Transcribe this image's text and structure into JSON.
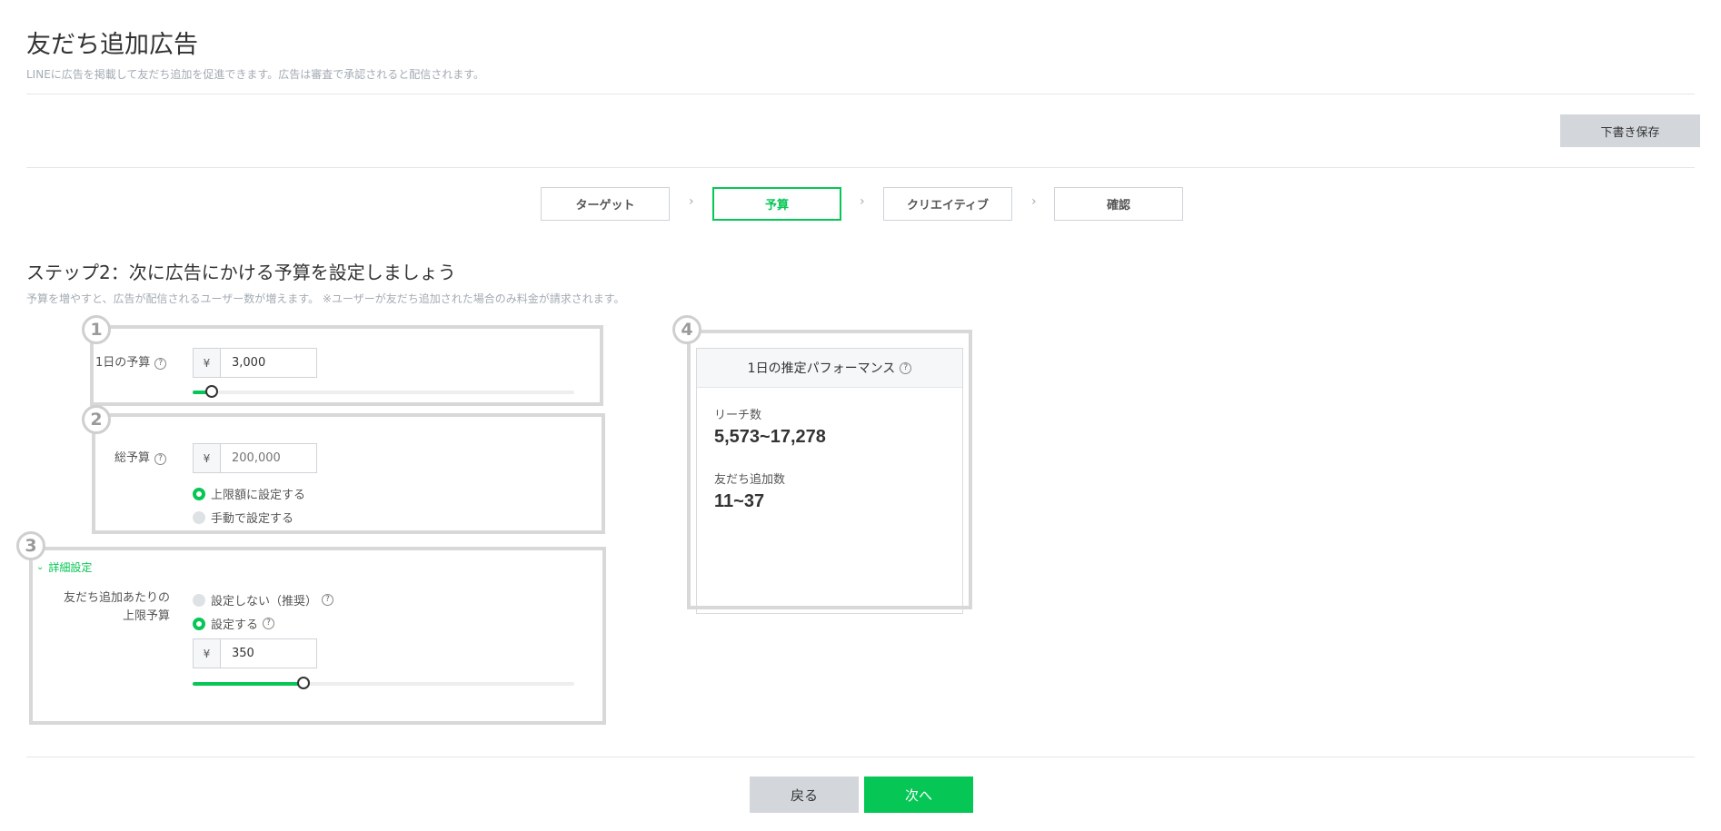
{
  "header": {
    "title": "友だち追加広告",
    "description": "LINEに広告を掲載して友だち追加を促進できます。広告は審査で承認されると配信されます。",
    "draft_save_label": "下書き保存"
  },
  "steps": [
    {
      "label": "ターゲット",
      "active": false
    },
    {
      "label": "予算",
      "active": true
    },
    {
      "label": "クリエイティブ",
      "active": false
    },
    {
      "label": "確認",
      "active": false
    }
  ],
  "step_separator": "›",
  "section": {
    "title": "ステップ2：次に広告にかける予算を設定しましょう",
    "description": "予算を増やすと、広告が配信されるユーザー数が増えます。 ※ユーザーが友だち追加された場合のみ料金が請求されます。"
  },
  "annotations": [
    "1",
    "2",
    "3",
    "4"
  ],
  "help_glyph": "?",
  "currency_symbol": "¥",
  "daily_budget": {
    "label": "1日の予算",
    "value": "3,000",
    "slider_fraction": 0.05
  },
  "total_budget": {
    "label": "総予算",
    "placeholder": "200,000",
    "options": [
      {
        "label": "上限額に設定する",
        "selected": true
      },
      {
        "label": "手動で設定する",
        "selected": false
      }
    ]
  },
  "advanced": {
    "toggle_label": "詳細設定",
    "chevron": "⌄",
    "cap_label_line1": "友だち追加あたりの",
    "cap_label_line2": "上限予算",
    "options": [
      {
        "label": "設定しない（推奨）",
        "selected": false
      },
      {
        "label": "設定する",
        "selected": true
      }
    ],
    "cap_value": "350",
    "slider_fraction": 0.29
  },
  "performance": {
    "title": "1日の推定パフォーマンス",
    "reach_label": "リーチ数",
    "reach_value": "5,573~17,278",
    "friends_label": "友だち追加数",
    "friends_value": "11~37"
  },
  "footer": {
    "back_label": "戻る",
    "next_label": "次へ"
  },
  "colors": {
    "accent": "#06c755",
    "muted_button": "#d3d7dc",
    "annotation_border": "#d8d8d8"
  }
}
